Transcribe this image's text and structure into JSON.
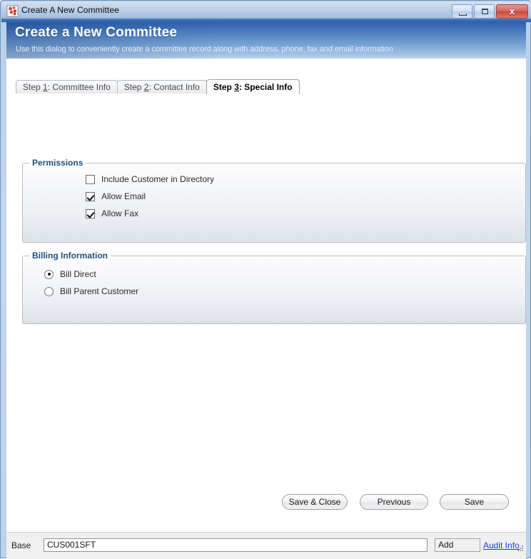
{
  "window": {
    "title": "Create A New Committee",
    "icon": "app-icon",
    "controls": {
      "minimize": "minimize-icon",
      "maximize": "maximize-icon",
      "close_label": "x"
    }
  },
  "banner": {
    "title": "Create a New Committee",
    "subtitle": "Use this dialog to conveniently create a committee record along with address, phone, fax and email information",
    "gradient_start": "#2e62ab",
    "gradient_end": "#bcd3ec"
  },
  "tabs": [
    {
      "prefix": "Step ",
      "mnemonic": "1",
      "suffix": ": Committee Info",
      "active": false
    },
    {
      "prefix": "Step ",
      "mnemonic": "2",
      "suffix": ": Contact Info",
      "active": false
    },
    {
      "prefix": "Step ",
      "mnemonic": "3",
      "suffix": ": Special Info",
      "active": true
    }
  ],
  "permissions": {
    "legend": "Permissions",
    "options": [
      {
        "label": "Include Customer in Directory",
        "checked": false
      },
      {
        "label": "Allow Email",
        "checked": true
      },
      {
        "label": "Allow Fax",
        "checked": true
      }
    ]
  },
  "billing": {
    "legend": "Billing Information",
    "options": [
      {
        "label": "Bill Direct",
        "selected": true
      },
      {
        "label": "Bill Parent Customer",
        "selected": false
      }
    ]
  },
  "buttons": {
    "save_close": "Save & Close",
    "previous": "Previous",
    "save": "Save"
  },
  "statusbar": {
    "label": "Base",
    "value": "CUS001SFT",
    "mode": "Add",
    "audit_link": "Audit Info",
    "link_color": "#1a3fcf",
    "grip": "resize-grip-icon"
  },
  "colors": {
    "legend_text": "#1f4e79",
    "window_border": "#6f93bd",
    "close_button": "#c44a3e"
  }
}
